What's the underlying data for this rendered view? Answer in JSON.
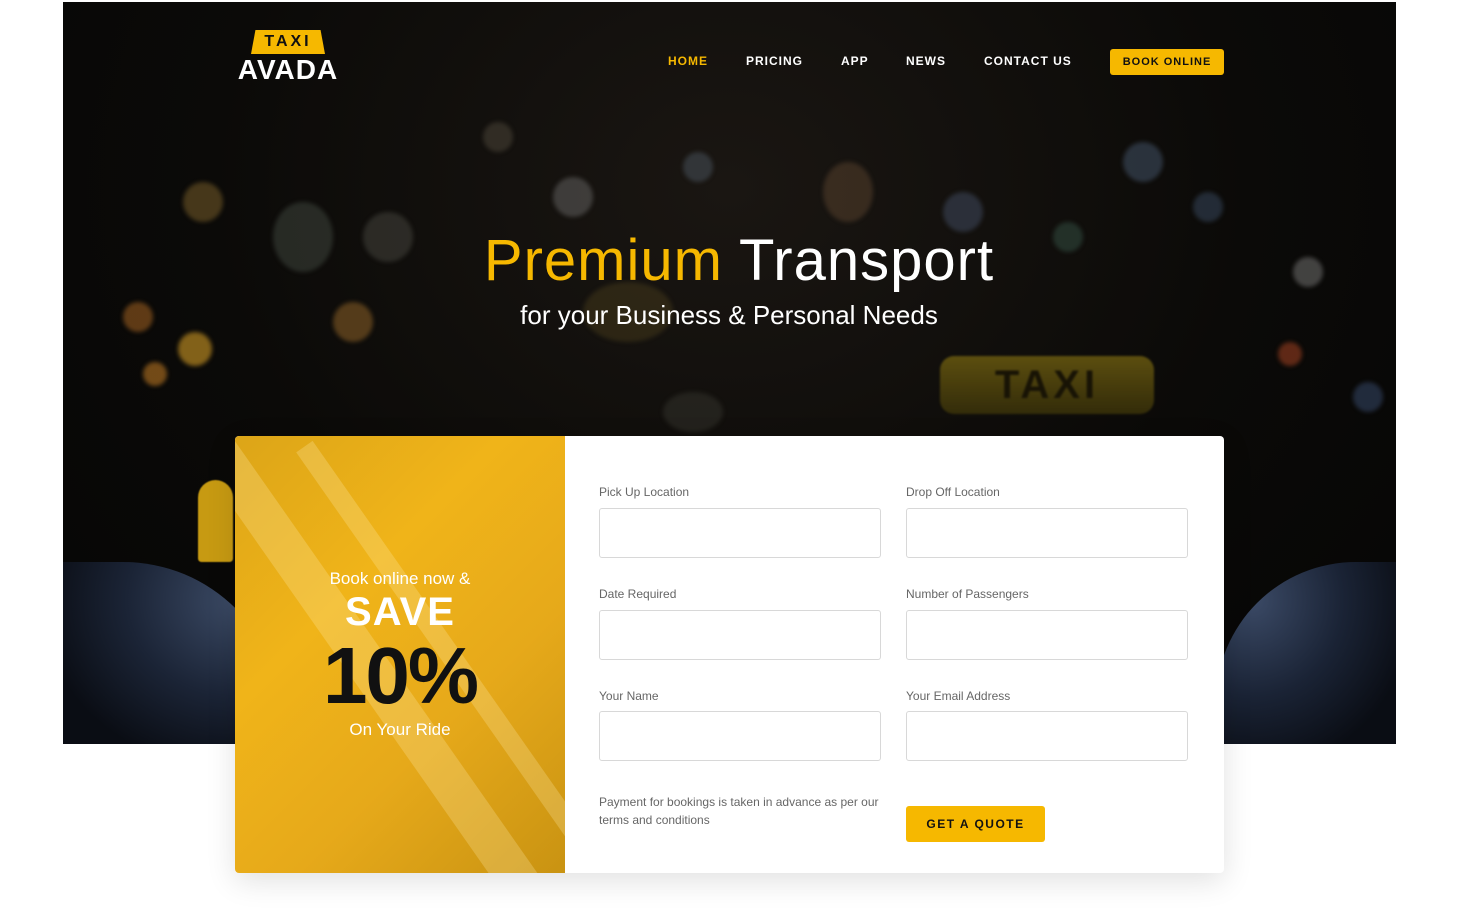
{
  "logo": {
    "top": "TAXI",
    "bottom": "AVADA"
  },
  "nav": {
    "items": [
      "HOME",
      "PRICING",
      "APP",
      "NEWS",
      "CONTACT US"
    ],
    "active": "HOME",
    "cta": "BOOK ONLINE"
  },
  "hero": {
    "title_accent": "Premium",
    "title_rest": "Transport",
    "subtitle": "for your Business & Personal Needs",
    "background_sign": "TAXI"
  },
  "promo": {
    "line1": "Book online now &",
    "line2": "SAVE",
    "line3": "10%",
    "line4": "On Your Ride"
  },
  "form": {
    "pickup_label": "Pick Up Location",
    "dropoff_label": "Drop Off Location",
    "date_label": "Date Required",
    "passengers_label": "Number of Passengers",
    "name_label": "Your Name",
    "email_label": "Your Email Address",
    "note": "Payment for bookings is taken in advance as per our terms and conditions",
    "submit": "GET A QUOTE"
  },
  "colors": {
    "accent": "#f6b800",
    "dark": "#0b0a08"
  }
}
